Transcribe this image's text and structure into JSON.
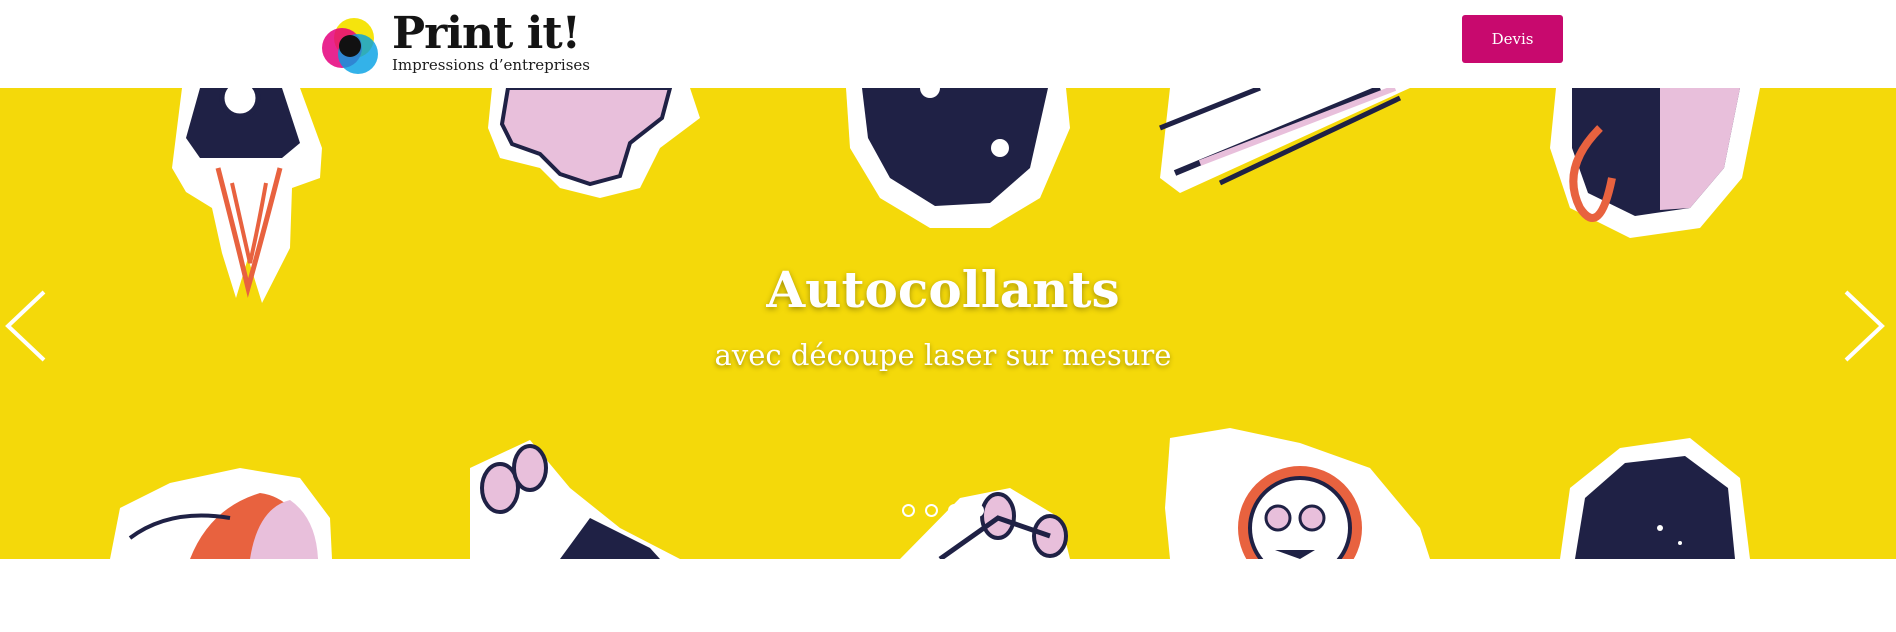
{
  "header": {
    "brand_name": "Print it!",
    "brand_tagline": "Impressions d’entreprises",
    "quote_button_label": "Devis"
  },
  "hero": {
    "title": "Autocollants",
    "subtitle": "avec découpe laser sur mesure",
    "background_color": "#f4d90a",
    "prev_icon": "chevron-left-icon",
    "next_icon": "chevron-right-icon",
    "slides_count": 4,
    "active_slide": 4
  },
  "colors": {
    "accent": "#c8096e",
    "sticker_navy": "#1f2145",
    "sticker_pink": "#e8bfdb",
    "sticker_orange": "#e8623f"
  }
}
